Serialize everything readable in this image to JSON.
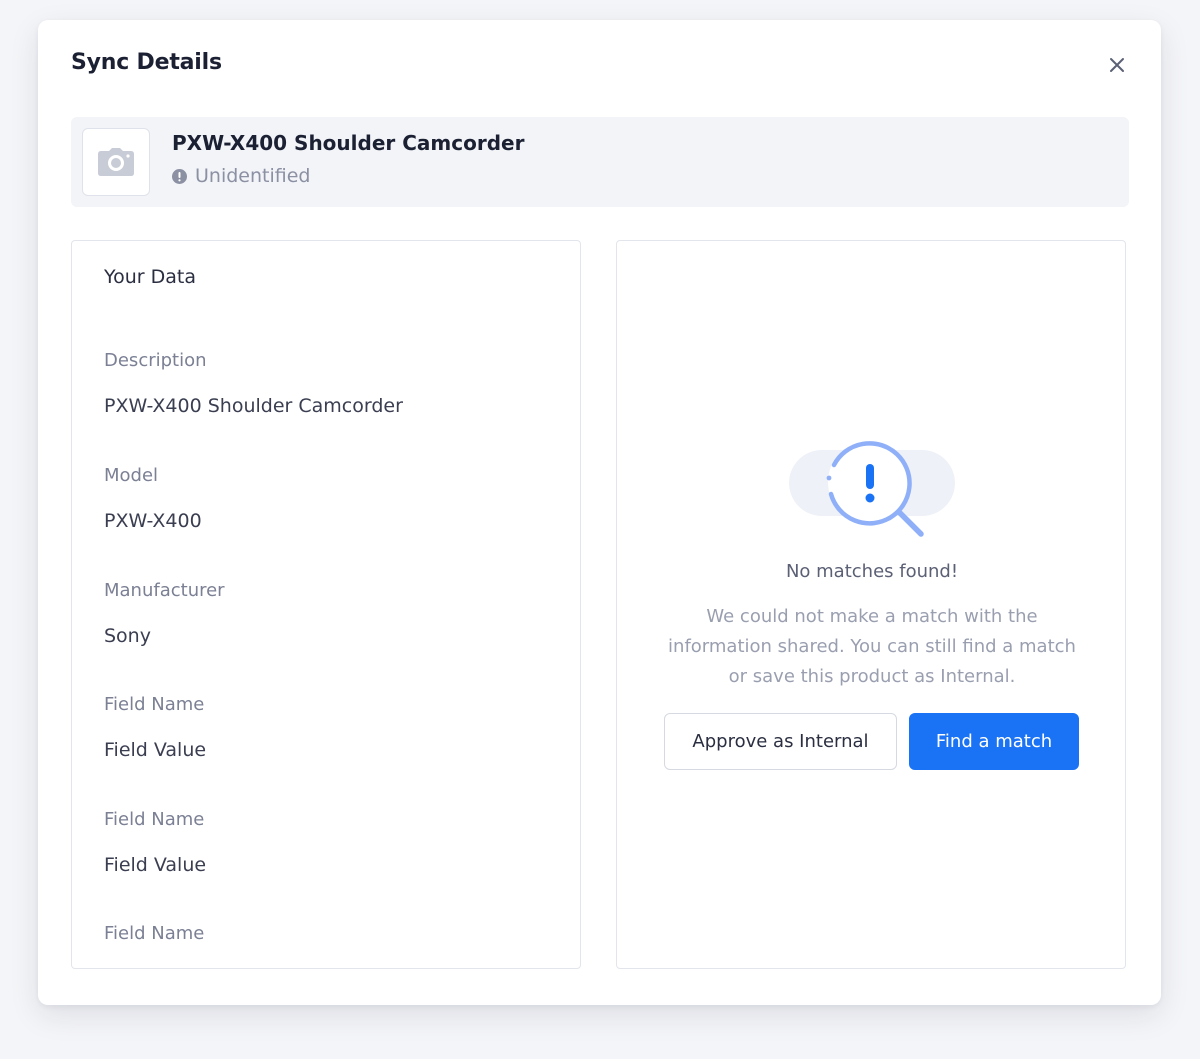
{
  "modal": {
    "title": "Sync Details"
  },
  "product": {
    "name": "PXW-X400 Shoulder Camcorder",
    "status": "Unidentified",
    "thumbnail_icon": "camera-icon",
    "status_icon": "info-icon"
  },
  "your_data": {
    "title": "Your Data",
    "fields": [
      {
        "label": "Description",
        "value": "PXW-X400 Shoulder Camcorder"
      },
      {
        "label": "Model",
        "value": "PXW-X400"
      },
      {
        "label": "Manufacturer",
        "value": "Sony"
      },
      {
        "label": "Field Name",
        "value": "Field Value"
      },
      {
        "label": "Field Name",
        "value": "Field Value"
      },
      {
        "label": "Field Name",
        "value": ""
      }
    ]
  },
  "match_panel": {
    "illustration_icon": "magnifier-alert-icon",
    "title": "No matches found!",
    "description_lines": [
      "We could not make a match with the",
      "information shared. You can still find a match",
      "or save this product as Internal."
    ],
    "approve_label": "Approve as Internal",
    "find_label": "Find a match"
  },
  "colors": {
    "accent": "#1a73f5",
    "illustration_blue": "#8fb0f8",
    "illustration_bg": "#eef1f8",
    "header_bg": "#f2f4f8"
  }
}
